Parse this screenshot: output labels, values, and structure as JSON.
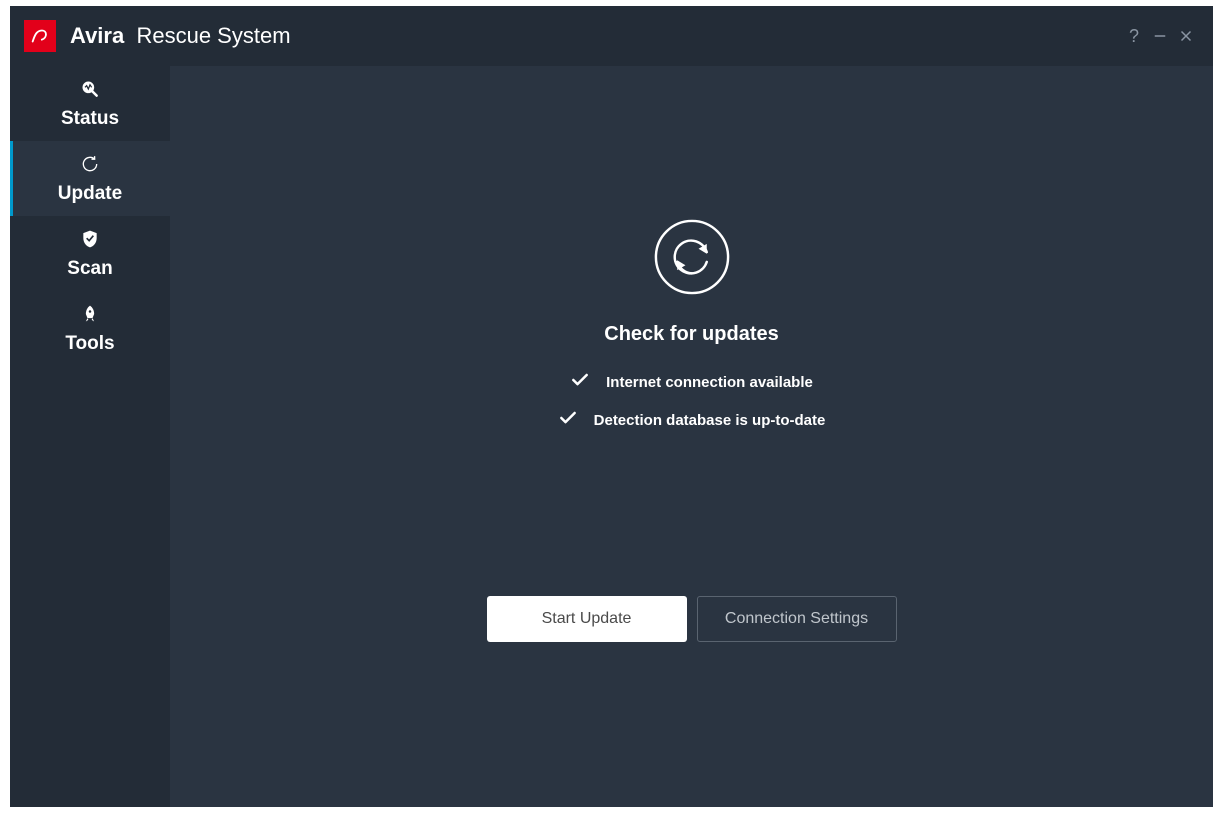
{
  "titlebar": {
    "brand": "Avira",
    "product": "Rescue System"
  },
  "sidebar": {
    "items": [
      {
        "label": "Status"
      },
      {
        "label": "Update"
      },
      {
        "label": "Scan"
      },
      {
        "label": "Tools"
      }
    ],
    "active_index": 1
  },
  "main": {
    "heading": "Check for updates",
    "status_lines": [
      "Internet connection available",
      "Detection database is up-to-date"
    ],
    "buttons": {
      "primary": "Start Update",
      "secondary": "Connection Settings"
    }
  }
}
